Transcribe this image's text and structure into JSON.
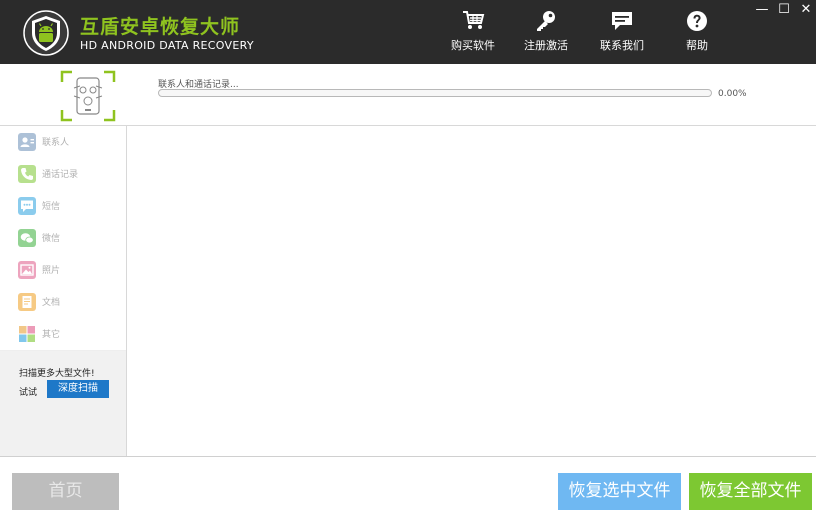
{
  "app": {
    "title": "互盾安卓恢复大师",
    "subtitle": "HD ANDROID DATA RECOVERY"
  },
  "nav": [
    {
      "label": "购买软件",
      "icon": "cart-icon"
    },
    {
      "label": "注册激活",
      "icon": "key-icon"
    },
    {
      "label": "联系我们",
      "icon": "chat-icon"
    },
    {
      "label": "帮助",
      "icon": "help-icon"
    }
  ],
  "window_controls": {
    "minimize": "—",
    "maximize": "☐",
    "close": "✕"
  },
  "scan": {
    "status_text": "联系人和通话记录...",
    "progress_fraction": 0.0,
    "progress_text": "0.00%"
  },
  "categories": [
    {
      "label": "联系人",
      "icon": "contacts-icon",
      "color": "#6b8fb8"
    },
    {
      "label": "通话记录",
      "icon": "phone-icon",
      "color": "#7dc832"
    },
    {
      "label": "短信",
      "icon": "sms-icon",
      "color": "#2ea3e0"
    },
    {
      "label": "微信",
      "icon": "wechat-icon",
      "color": "#3bb03b"
    },
    {
      "label": "照片",
      "icon": "photo-icon",
      "color": "#e05a8a"
    },
    {
      "label": "文档",
      "icon": "document-icon",
      "color": "#f0a020"
    },
    {
      "label": "其它",
      "icon": "other-icon",
      "color": "#e8a33a"
    }
  ],
  "promo": {
    "text": "扫描更多大型文件!",
    "try_label": "试试",
    "deep_scan_label": "深度扫描"
  },
  "footer": {
    "home_label": "首页",
    "recover_selected_label": "恢复选中文件",
    "recover_all_label": "恢复全部文件"
  }
}
